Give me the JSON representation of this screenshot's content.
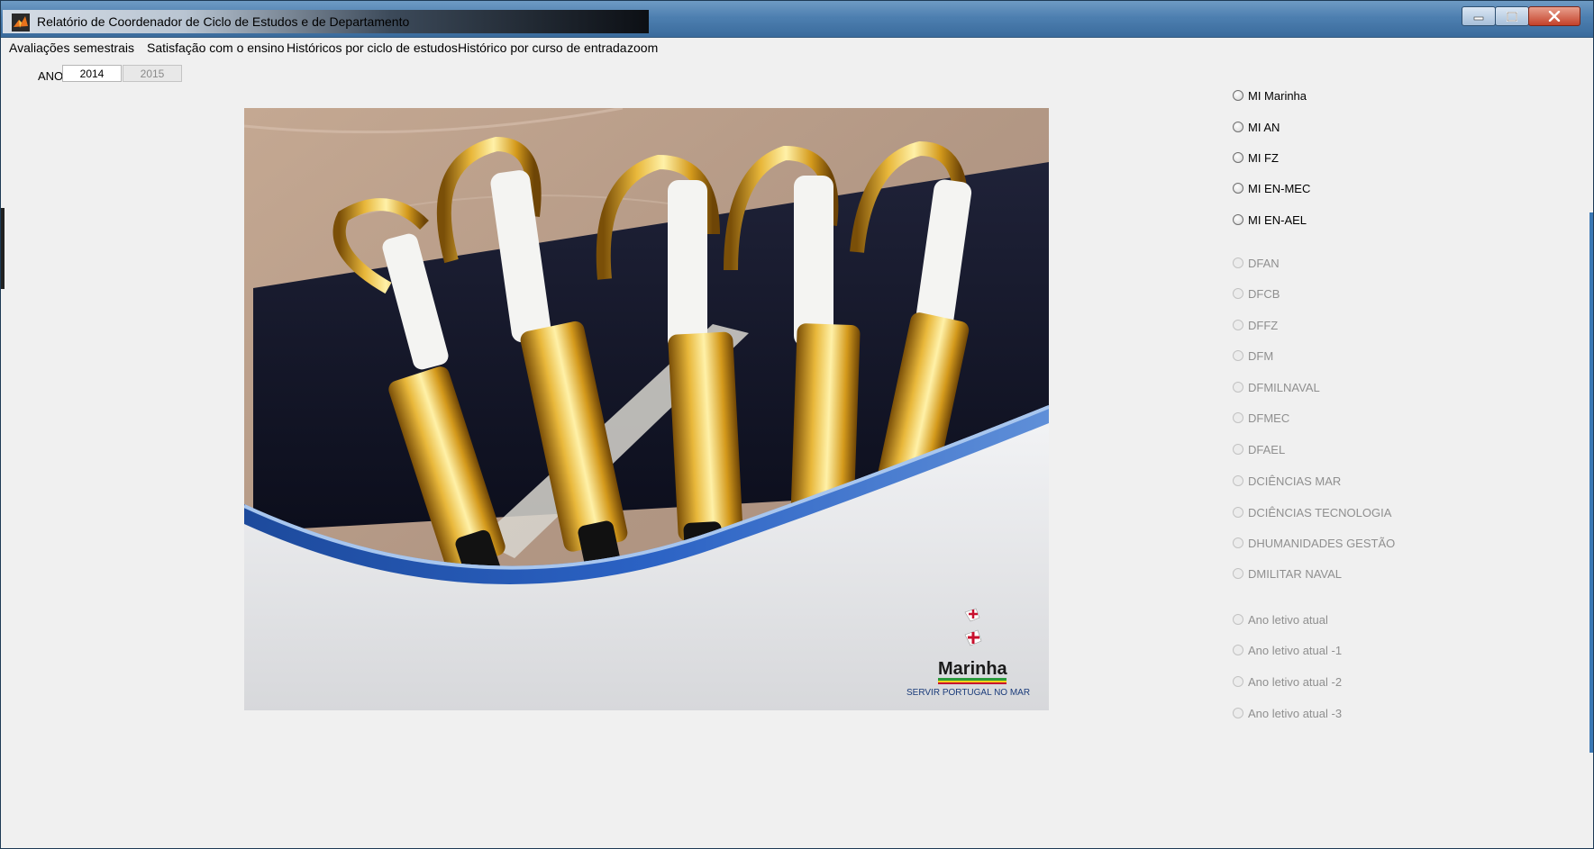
{
  "window": {
    "title": "Relatório de Coordenador de Ciclo de Estudos e de Departamento"
  },
  "menubar": {
    "items": [
      "Avaliações semestrais",
      "Satisfação com o ensino",
      "Históricos por ciclo de estudos",
      "Histórico por curso de entrada",
      "zoom"
    ]
  },
  "year_selector": {
    "label": "ANO",
    "selected": "2014",
    "other": "2015"
  },
  "image": {
    "logo_text": "Marinha",
    "slogan": "SERVIR PORTUGAL NO MAR"
  },
  "programs": [
    "MI Marinha",
    "MI AN",
    "MI FZ",
    "MI EN-MEC",
    "MI EN-AEL"
  ],
  "departments": [
    "DFAN",
    "DFCB",
    "DFFZ",
    "DFM",
    "DFMILNAVAL",
    "DFMEC",
    "DFAEL",
    "DCIÊNCIAS MAR",
    "DCIÊNCIAS TECNOLOGIA",
    "DHUMANIDADES GESTÃO",
    "DMILITAR NAVAL"
  ],
  "academic_years": [
    "Ano letivo atual",
    "Ano letivo atual -1",
    "Ano letivo atual -2",
    "Ano letivo atual -3"
  ],
  "colors": {
    "window_bg": "#f0f0f0",
    "titlebar": "#4d7fb0",
    "logo_red": "#c8102e",
    "wave_blue": "#1f4fa0",
    "gold": "#d4a017"
  }
}
